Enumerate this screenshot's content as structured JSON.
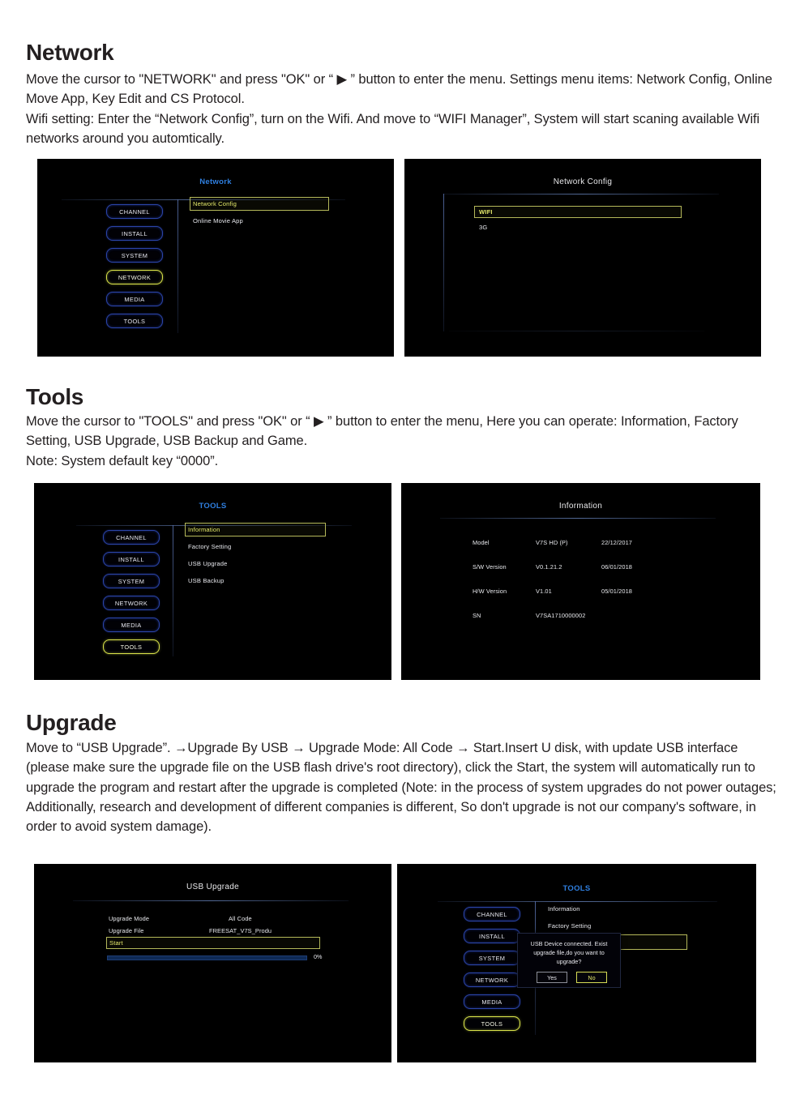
{
  "sections": [
    {
      "heading": "Network",
      "paragraphs": [
        "Move the cursor to \"NETWORK\" and press \"OK\" or “ ▶ ” button to enter the menu. Settings menu items: Network Config, Online Move App, Key Edit and CS Protocol.",
        "Wifi setting: Enter the “Network Config”, turn on the Wifi. And move to “WIFI Manager”, System will start scaning available Wifi networks around you automtically."
      ]
    },
    {
      "heading": "Tools",
      "paragraphs": [
        "Move the cursor to \"TOOLS\" and press \"OK\" or “ ▶ ” button to enter the menu, Here you can operate: Information, Factory Setting,  USB Upgrade, USB Backup and Game.",
        "Note: System default key “0000”."
      ]
    },
    {
      "heading": "Upgrade",
      "paragraphs": [
        "Move to “USB Upgrade”. →Upgrade By USB → Upgrade Mode: All Code → Start.Insert U disk, with update USB interface (please make sure the upgrade file on the USB flash drive's root directory), click the Start, the system will automatically run to upgrade the program and restart after the upgrade is completed (Note: in the process of system upgrades do not power outages; Additionally, research and development of different companies is different, So don't upgrade is not our company's software, in order to avoid system damage)."
      ]
    }
  ],
  "shot_network_menu": {
    "title": "Network",
    "nav": [
      {
        "label": "CHANNEL",
        "selected": false
      },
      {
        "label": "INSTALL",
        "selected": false
      },
      {
        "label": "SYSTEM",
        "selected": false
      },
      {
        "label": "NETWORK",
        "selected": true
      },
      {
        "label": "MEDIA",
        "selected": false
      },
      {
        "label": "TOOLS",
        "selected": false
      }
    ],
    "items": [
      {
        "label": "Network Config",
        "selected": true
      },
      {
        "label": "Online Movie App",
        "selected": false
      }
    ]
  },
  "shot_network_config": {
    "title": "Network Config",
    "items": [
      {
        "label": "WIFI",
        "selected": true
      },
      {
        "label": "3G",
        "selected": false
      }
    ]
  },
  "shot_tools_menu": {
    "title": "TOOLS",
    "nav": [
      {
        "label": "CHANNEL",
        "selected": false
      },
      {
        "label": "INSTALL",
        "selected": false
      },
      {
        "label": "SYSTEM",
        "selected": false
      },
      {
        "label": "NETWORK",
        "selected": false
      },
      {
        "label": "MEDIA",
        "selected": false
      },
      {
        "label": "TOOLS",
        "selected": true
      }
    ],
    "items": [
      {
        "label": "Information",
        "selected": true
      },
      {
        "label": "Factory Setting",
        "selected": false
      },
      {
        "label": "USB Upgrade",
        "selected": false
      },
      {
        "label": "USB Backup",
        "selected": false
      }
    ]
  },
  "shot_information": {
    "title": "Information",
    "rows": [
      {
        "label": "Model",
        "value": "V7S HD (P)",
        "date": "22/12/2017"
      },
      {
        "label": "S/W Version",
        "value": "V0.1.21.2",
        "date": "06/01/2018"
      },
      {
        "label": "H/W Version",
        "value": "V1.01",
        "date": "05/01/2018"
      },
      {
        "label": "SN",
        "value": "V7SA1710000002",
        "date": ""
      }
    ]
  },
  "shot_usb_upgrade": {
    "title": "USB Upgrade",
    "rows": [
      {
        "label": "Upgrade Mode",
        "value": "All Code"
      },
      {
        "label": "Upgrade File",
        "value": "FREESAT_V7S_Produ"
      }
    ],
    "start_label": "Start",
    "progress_percent": "0%",
    "progress_value": 0
  },
  "shot_tools_dialog": {
    "title": "TOOLS",
    "nav": [
      {
        "label": "CHANNEL",
        "selected": false
      },
      {
        "label": "INSTALL",
        "selected": false
      },
      {
        "label": "SYSTEM",
        "selected": false
      },
      {
        "label": "NETWORK",
        "selected": false
      },
      {
        "label": "MEDIA",
        "selected": false
      },
      {
        "label": "TOOLS",
        "selected": true
      }
    ],
    "items": [
      {
        "label": "Information",
        "selected": false
      },
      {
        "label": "Factory Setting",
        "selected": false
      }
    ],
    "dialog": {
      "message": "USB Device connected.  Exist upgrade file,do you want to upgrade?",
      "yes_label": "Yes",
      "no_label": "No",
      "selected_button": "No"
    }
  },
  "colors": {
    "osd_background": "#000000",
    "title_blue": "#2f7fe0",
    "title_white": "#e8e8ea",
    "nav_border": "#2b44a8",
    "selection_yellow": "#d9e24a",
    "text_white": "#e9eaee",
    "progress_fill": "#0f2a55"
  }
}
